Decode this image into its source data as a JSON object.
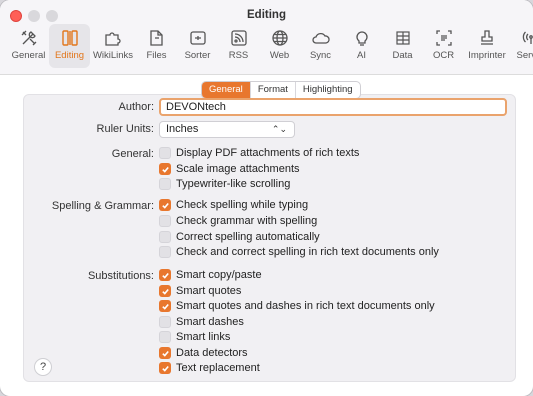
{
  "window": {
    "title": "Editing"
  },
  "toolbar": {
    "items": [
      {
        "label": "General",
        "icon": "tools-icon"
      },
      {
        "label": "Editing",
        "icon": "editing-icon",
        "active": true
      },
      {
        "label": "WikiLinks",
        "icon": "puzzle-icon"
      },
      {
        "label": "Files",
        "icon": "files-icon"
      },
      {
        "label": "Sorter",
        "icon": "sorter-icon"
      },
      {
        "label": "RSS",
        "icon": "rss-icon"
      },
      {
        "label": "Web",
        "icon": "globe-icon"
      },
      {
        "label": "Sync",
        "icon": "cloud-icon"
      },
      {
        "label": "AI",
        "icon": "lightbulb-icon"
      },
      {
        "label": "Data",
        "icon": "data-icon"
      },
      {
        "label": "OCR",
        "icon": "ocr-icon"
      },
      {
        "label": "Imprinter",
        "icon": "stamp-icon"
      },
      {
        "label": "Server",
        "icon": "broadcast-icon"
      }
    ]
  },
  "tabs": [
    {
      "label": "General",
      "active": true
    },
    {
      "label": "Format"
    },
    {
      "label": "Highlighting"
    }
  ],
  "author": {
    "label": "Author:",
    "value": "DEVONtech"
  },
  "ruler": {
    "label": "Ruler Units:",
    "value": "Inches"
  },
  "general": {
    "label": "General:",
    "options": [
      {
        "label": "Display PDF attachments of rich texts",
        "checked": false
      },
      {
        "label": "Scale image attachments",
        "checked": true
      },
      {
        "label": "Typewriter-like scrolling",
        "checked": false
      }
    ]
  },
  "spelling": {
    "label": "Spelling & Grammar:",
    "options": [
      {
        "label": "Check spelling while typing",
        "checked": true
      },
      {
        "label": "Check grammar with spelling",
        "checked": false
      },
      {
        "label": "Correct spelling automatically",
        "checked": false
      },
      {
        "label": "Check and correct spelling in rich text documents only",
        "checked": false
      }
    ]
  },
  "substitutions": {
    "label": "Substitutions:",
    "options": [
      {
        "label": "Smart copy/paste",
        "checked": true
      },
      {
        "label": "Smart quotes",
        "checked": true
      },
      {
        "label": "Smart quotes and dashes in rich text documents only",
        "checked": true
      },
      {
        "label": "Smart dashes",
        "checked": false
      },
      {
        "label": "Smart links",
        "checked": false
      },
      {
        "label": "Data detectors",
        "checked": true
      },
      {
        "label": "Text replacement",
        "checked": true
      }
    ]
  },
  "help": {
    "label": "?"
  },
  "colors": {
    "accent": "#e8772e"
  }
}
